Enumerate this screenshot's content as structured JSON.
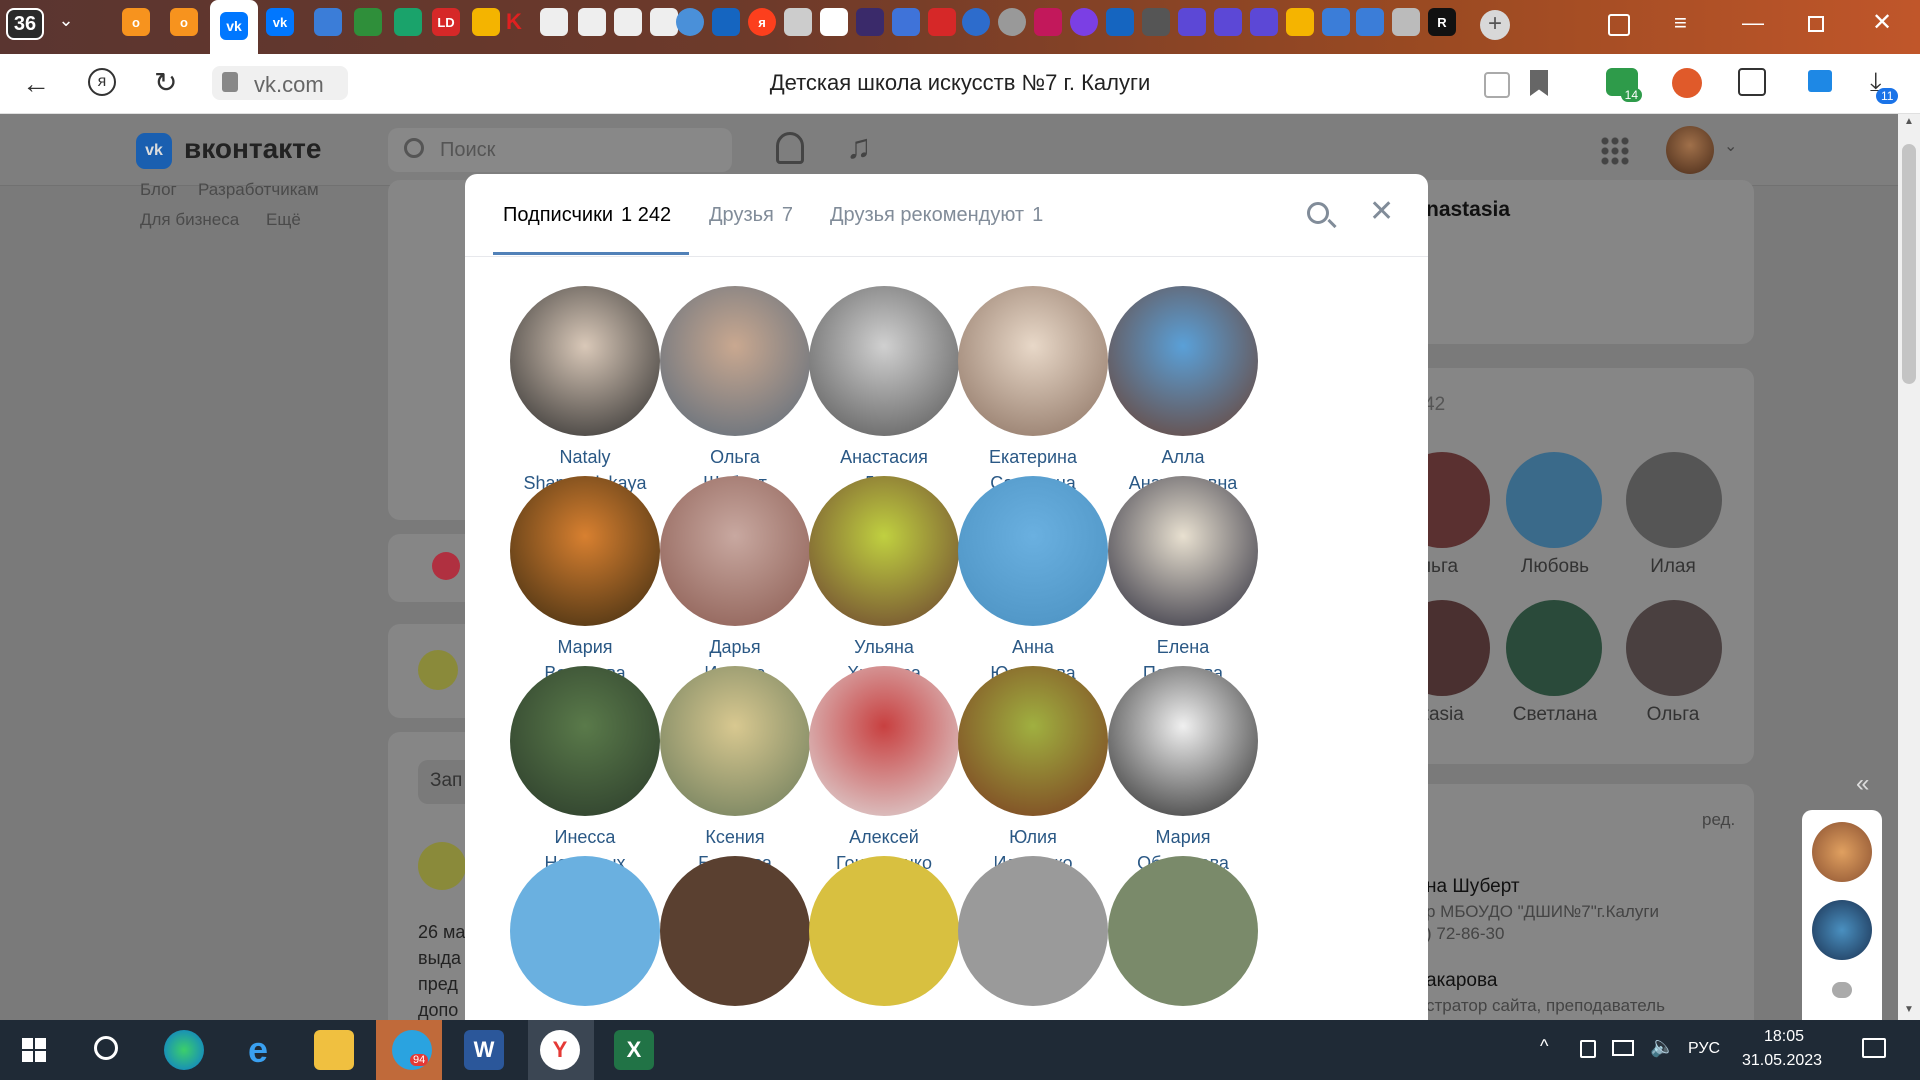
{
  "browser": {
    "tab_count": "36",
    "url": "vk.com",
    "page_title": "Детская школа искусств №7 г. Калуги",
    "downloads_badge": "11",
    "ext_badge": "14"
  },
  "vk": {
    "logo": "вконтакте",
    "search_placeholder": "Поиск",
    "left_links": [
      "Блог",
      "Разработчикам",
      "Для бизнеса",
      "Ещё"
    ],
    "right_header_name": "nastasia",
    "right_count": "42",
    "right_people": [
      "льга",
      "Любовь",
      "Илая",
      "stasia",
      "Светлана",
      "Ольга"
    ],
    "edit_label": "ред.",
    "contacts": [
      {
        "name": "на Шуберт",
        "role": "р МБОУДО \"ДШИ№7\"г.Калуги",
        "phone": ") 72-86-30"
      },
      {
        "name": "акарова",
        "role": "стратор сайта, преподаватель"
      }
    ],
    "post_date_fragment": "26 ма",
    "post_lines": [
      "выда",
      "пред",
      "допо"
    ],
    "write_fragment": "Зап"
  },
  "modal": {
    "tabs": [
      {
        "label": "Подписчики",
        "count": "1 242"
      },
      {
        "label": "Друзья",
        "count": "7"
      },
      {
        "label": "Друзья рекомендуют",
        "count": "1"
      }
    ],
    "people": [
      {
        "first": "Nataly",
        "last": "Shamatulskaya"
      },
      {
        "first": "Ольга",
        "last": "Шуберт"
      },
      {
        "first": "Анастасия",
        "last": "Дояр"
      },
      {
        "first": "Екатерина",
        "last": "Самарина"
      },
      {
        "first": "Алла",
        "last": "Анатольевна"
      },
      {
        "first": "Мария",
        "last": "Воронова"
      },
      {
        "first": "Дарья",
        "last": "Исаева"
      },
      {
        "first": "Ульяна",
        "last": "Храмова"
      },
      {
        "first": "Анна",
        "last": "Юденкова"
      },
      {
        "first": "Елена",
        "last": "Пояркова"
      },
      {
        "first": "Инесса",
        "last": "Нагорных"
      },
      {
        "first": "Ксения",
        "last": "Бошкова"
      },
      {
        "first": "Алексей",
        "last": "Гончаренко"
      },
      {
        "first": "Юлия",
        "last": "Ильченко"
      },
      {
        "first": "Мария",
        "last": "Образцова"
      }
    ]
  },
  "taskbar": {
    "time": "18:05",
    "date": "31.05.2023",
    "lang": "РУС",
    "telegram_badge": "94"
  },
  "colors": {
    "vk_blue": "#0077ff",
    "link": "#2a5885",
    "tab_active": "#000000"
  }
}
